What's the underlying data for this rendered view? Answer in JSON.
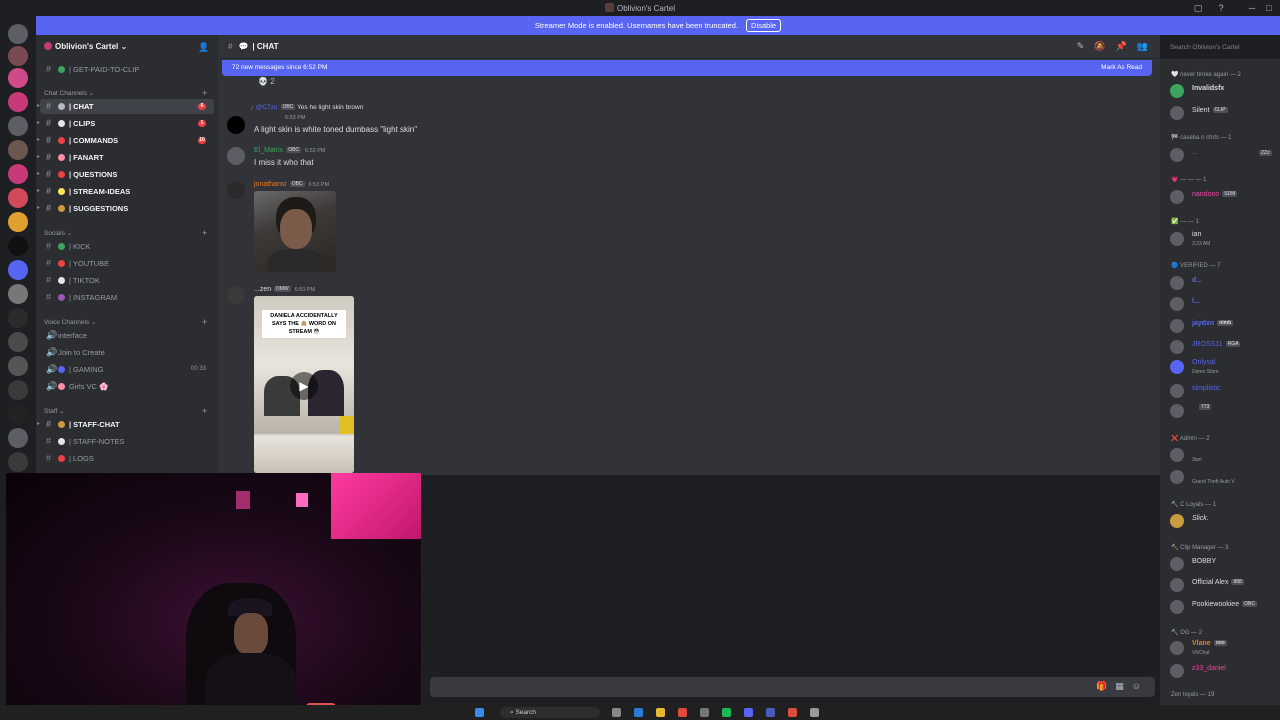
{
  "window": {
    "title": "Oblivion's Cartel",
    "min": "─",
    "max": "□",
    "close": "✕"
  },
  "banner": {
    "text": "Streamer Mode is enabled. Usernames have been truncated.",
    "button": "Disable"
  },
  "server_header": {
    "name": "Oblivion's Cartel",
    "chevron": "⌄"
  },
  "sidebar": {
    "top_channel": {
      "label": "| GET-PAID-TO-CLIP"
    },
    "categories": [
      {
        "label": "Chat Channels ⌄",
        "plus": "+"
      },
      {
        "label": "Socials ⌄",
        "plus": "+"
      },
      {
        "label": "Voice Channels ⌄",
        "plus": "+"
      },
      {
        "label": "Staff ⌄",
        "plus": "+"
      }
    ],
    "chat_channels": [
      {
        "label": "| CHAT",
        "badge": "6",
        "color": "#b5bac1"
      },
      {
        "label": "| CLIPS",
        "badge": "1",
        "color": "#e6e6e6"
      },
      {
        "label": "| COMMANDS",
        "badge": "10",
        "color": "#ed4245"
      },
      {
        "label": "| FANART",
        "badge": "",
        "color": "#ff8fa3"
      },
      {
        "label": "| QUESTIONS",
        "badge": "",
        "color": "#ed4245"
      },
      {
        "label": "| STREAM-IDEAS",
        "badge": "",
        "color": "#fee75c"
      },
      {
        "label": "| SUGGESTIONS",
        "badge": "",
        "color": "#c89b3c"
      }
    ],
    "socials": [
      {
        "label": "| KICK",
        "color": "#3ba55d"
      },
      {
        "label": "| YOUTUBE",
        "color": "#ed4245"
      },
      {
        "label": "| TIKTOK",
        "color": "#e6e6e6"
      },
      {
        "label": "| INSTAGRAM",
        "color": "#9b59b6"
      }
    ],
    "voice": [
      {
        "label": "interface",
        "count": ""
      },
      {
        "label": "Join to Create",
        "count": ""
      },
      {
        "label": "| GAMING",
        "count": "00  33"
      },
      {
        "label": "Girls VC 🌸",
        "count": ""
      }
    ],
    "staff": [
      {
        "label": "| STAFF-CHAT",
        "color": "#c89b3c"
      },
      {
        "label": "| STAFF-NOTES",
        "color": "#e6e6e6"
      },
      {
        "label": "| LOGS",
        "color": "#ed4245"
      }
    ]
  },
  "chat_header": {
    "name": "| CHAT",
    "search_placeholder": "Search Oblivion's Cartel"
  },
  "new_messages": {
    "text": "72 new messages since 6:52 PM",
    "mark": "Mark As Read"
  },
  "reaction": {
    "emoji": "💀",
    "count": "2"
  },
  "messages": [
    {
      "reply_name": "@C7zu",
      "reply_tag": "OBC",
      "reply_text": "Yes he light skin brown",
      "time": "6:53 PM",
      "text": "A light skin is white toned dumbass \"light skin\"",
      "name_color": "#5865f2"
    },
    {
      "name": "El_Matrix",
      "tag": "OBC",
      "time": "6:53 PM",
      "text": "I miss it who that",
      "name_color": "#3ba55d"
    },
    {
      "name": "jonathansr",
      "tag": "OBC",
      "time": "6:53 PM",
      "name_color": "#e67e22"
    },
    {
      "name": "...zen",
      "tag": "DMW",
      "time": "6:53 PM",
      "caption": "DANIELA ACCIDENTALLY SAYS THE 🙊 WORD ON STREAM 😳",
      "name_color": "#dbdee1"
    }
  ],
  "members": {
    "groups": [
      {
        "label": "🤍 never broke again — 2"
      },
      {
        "label": "🏁 caseba n chrls — 1"
      },
      {
        "label": "💗 — — — 1"
      },
      {
        "label": "✅ — — 1"
      },
      {
        "label": "🔵 VERIFIED — 7"
      },
      {
        "label": "❌ Admin — 2"
      },
      {
        "label": "🔨 C Loyals — 1"
      },
      {
        "label": "🔨 Clip Manager — 3"
      },
      {
        "label": "🔨 OG — 2"
      },
      {
        "label": "Zen loyals — 19"
      }
    ],
    "list": [
      {
        "name": "Invalidsfx",
        "sub": "",
        "color": "#f2f3f5"
      },
      {
        "name": "Silent",
        "sub": "",
        "color": "#dbdee1",
        "tag": "CLIP"
      },
      {
        "name": "...",
        "sub": "",
        "color": "#4e5058",
        "tag": "ZZz"
      },
      {
        "name": "nandooo",
        "sub": "",
        "color": "#eb459e",
        "tag": "SDM"
      },
      {
        "name": "ian",
        "sub": "3:23 AM",
        "color": "#dbdee1"
      },
      {
        "name": "d...",
        "sub": "",
        "color": "#5865f2"
      },
      {
        "name": "l...",
        "sub": "",
        "color": "#5865f2"
      },
      {
        "name": "jaydxn",
        "sub": "",
        "color": "#5865f2",
        "tag": "nimb"
      },
      {
        "name": "JROSS11",
        "sub": "",
        "color": "#5865f2",
        "tag": "RGA"
      },
      {
        "name": "Onlysal",
        "sub": "Demo Store",
        "color": "#5865f2"
      },
      {
        "name": "simplistic",
        "sub": "",
        "color": "#5865f2"
      },
      {
        "name": "",
        "sub": "",
        "color": "#5865f2",
        "tag": "773"
      },
      {
        "name": "",
        "sub": "3am",
        "color": "#eb459e"
      },
      {
        "name": "",
        "sub": "Grand Theft Auto V",
        "color": "#eb459e"
      },
      {
        "name": "Slick.",
        "sub": "",
        "color": "#dbdee1"
      },
      {
        "name": "BOBBY",
        "sub": "",
        "color": "#dbdee1"
      },
      {
        "name": "Official Alex",
        "sub": "",
        "color": "#dbdee1",
        "tag": "888"
      },
      {
        "name": "Pookiewookiee",
        "sub": "",
        "color": "#dbdee1",
        "tag": "OBC"
      },
      {
        "name": "Vlane",
        "sub": "VRChat",
        "color": "#e67e22",
        "tag": "ooo"
      },
      {
        "name": "z33_daniel",
        "sub": "",
        "color": "#eb459e"
      }
    ]
  },
  "taskbar": {
    "search": "Search"
  },
  "icons": {
    "hash": "#",
    "bubble": "💬",
    "pin": "📌",
    "mute": "🔕",
    "members": "👥",
    "gift": "🎁",
    "gif": "▦",
    "emoji": "☺",
    "play": "▶"
  },
  "colors": {
    "accent": "#5865f2",
    "unread": "#f23f43"
  }
}
